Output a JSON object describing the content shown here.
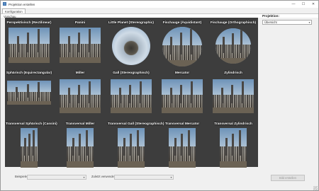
{
  "window": {
    "title": "Projektion erstellen",
    "controls": {
      "minimize": "—",
      "maximize": "☐",
      "close": "✕"
    }
  },
  "tabs": [
    {
      "label": "Konfiguration",
      "active": true
    }
  ],
  "subbar": {
    "label": "Vorschau"
  },
  "projections": [
    {
      "label": "Perspektivisch (Rectilinear)",
      "style": "rect"
    },
    {
      "label": "Panini",
      "style": "rect"
    },
    {
      "label": "Little Planet (Stereographic)",
      "style": "planet"
    },
    {
      "label": "Fischauge (Äquidistant)",
      "style": "fisheye"
    },
    {
      "label": "Fischauge (Orthographisch)",
      "style": "fisheye-small"
    },
    {
      "label": "Sphärisch (Equirectangular)",
      "style": "wide"
    },
    {
      "label": "Miller",
      "style": "wide-tall"
    },
    {
      "label": "Gall (Stereographisch)",
      "style": "wide-tall"
    },
    {
      "label": "Mercator",
      "style": "wide-tall"
    },
    {
      "label": "Zylindrisch",
      "style": "wide-tall"
    },
    {
      "label": "Transversal Sphärisch (Cassini)",
      "style": "narrow"
    },
    {
      "label": "Transversal Miller",
      "style": "narrow-wide"
    },
    {
      "label": "Transversal Gall (Stereographisch)",
      "style": "narrow-wide"
    },
    {
      "label": "Transversal Mercator",
      "style": "narrow-wide"
    },
    {
      "label": "Transversal Zylindrisch",
      "style": "narrow-wide"
    }
  ],
  "sidebar": {
    "projection_label": "Projektion:",
    "projection_value": "Übersicht"
  },
  "bottom": {
    "example_label": "Beispiele",
    "example_value": "",
    "recent_label": "Zuletzt verwendet",
    "recent_value": "",
    "apply_button": "Bild erstellen"
  },
  "colors": {
    "grid_background": "#3d3d3d",
    "window_background": "#f0f0f0"
  }
}
